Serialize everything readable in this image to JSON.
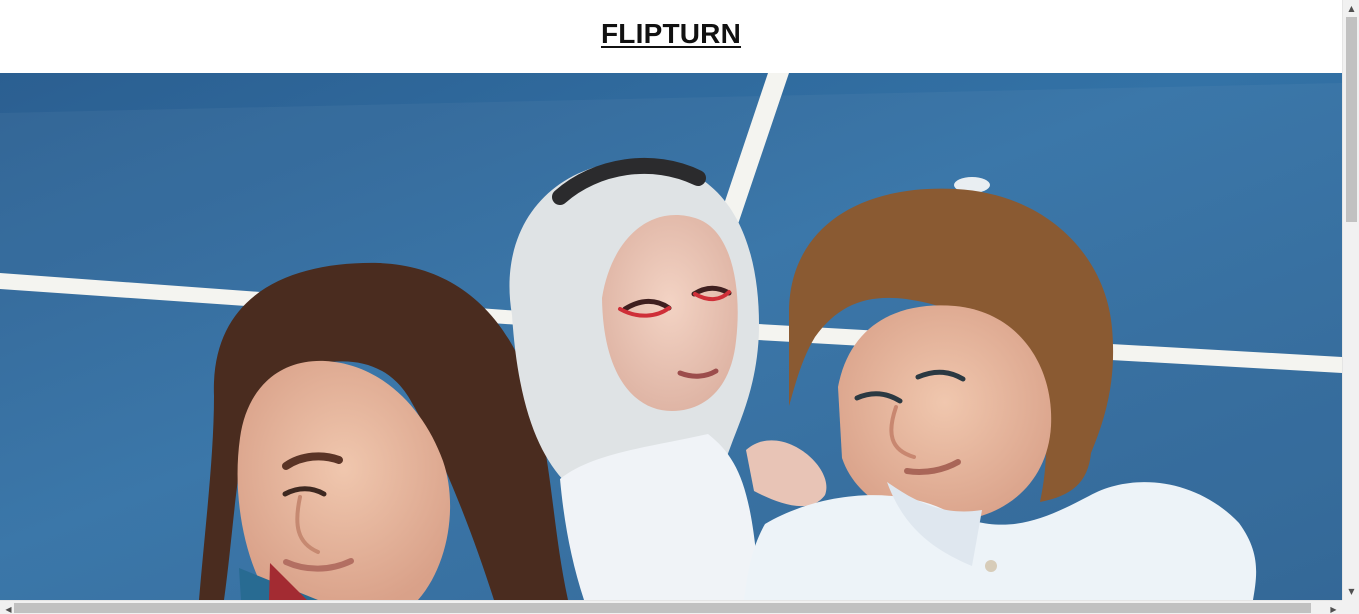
{
  "header": {
    "title": "FLIPTURN"
  },
  "hero": {
    "alt": "Three band members sitting on a blue sports court"
  },
  "scrollbars": {
    "up_icon": "triangle-up",
    "down_icon": "triangle-down",
    "left_icon": "triangle-left",
    "right_icon": "triangle-right",
    "up_glyph": "▲",
    "down_glyph": "▼",
    "left_glyph": "◀",
    "right_glyph": "▶"
  },
  "colors": {
    "court_blue": "#2f6697",
    "court_line": "#f4f4f0",
    "title_text": "#111111",
    "scroll_track": "#f1f1f1",
    "scroll_thumb": "#c1c1c1"
  }
}
